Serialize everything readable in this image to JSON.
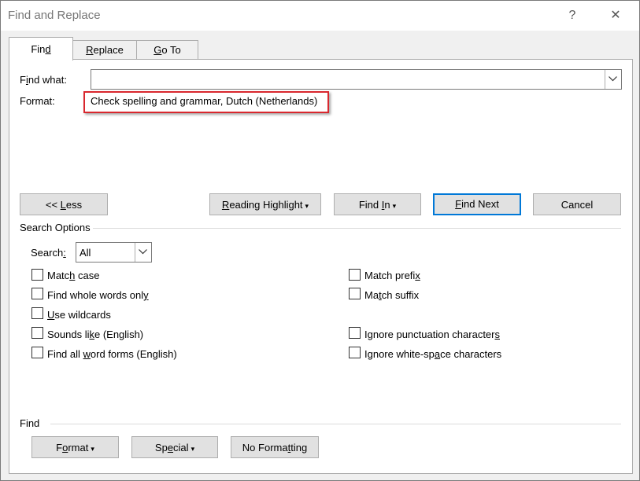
{
  "window": {
    "title": "Find and Replace",
    "help_glyph": "?",
    "close_glyph": "✕"
  },
  "tabs": [
    {
      "label_pre": "Fin",
      "label_ul": "d",
      "label_post": ""
    },
    {
      "label_pre": "",
      "label_ul": "R",
      "label_post": "eplace"
    },
    {
      "label_pre": "",
      "label_ul": "G",
      "label_post": "o To"
    }
  ],
  "find": {
    "label_pre": "F",
    "label_ul": "i",
    "label_post": "nd what:",
    "value": "",
    "format_label": "Format:",
    "format_value": "Check spelling and grammar, Dutch (Netherlands)"
  },
  "buttons": {
    "less_pre": "<< ",
    "less_ul": "L",
    "less_post": "ess",
    "reading_ul": "R",
    "reading_post": "eading Highlight",
    "findin_pre": "Find ",
    "findin_ul": "I",
    "findin_post": "n",
    "findnext_ul": "F",
    "findnext_post": "ind Next",
    "cancel": "Cancel",
    "caret": "▾"
  },
  "search_options": {
    "heading": "Search Options",
    "search_label_pre": "Search",
    "search_label_ul": ":",
    "search_value": "All",
    "left": [
      {
        "pre": "Matc",
        "ul": "h",
        "post": " case"
      },
      {
        "pre": "Find whole words onl",
        "ul": "y",
        "post": ""
      },
      {
        "pre": "",
        "ul": "U",
        "post": "se wildcards"
      },
      {
        "pre": "Sounds li",
        "ul": "k",
        "post": "e (English)"
      },
      {
        "pre": "Find all ",
        "ul": "w",
        "post": "ord forms (English)"
      }
    ],
    "right": [
      {
        "pre": "Match prefi",
        "ul": "x",
        "post": ""
      },
      {
        "pre": "Ma",
        "ul": "t",
        "post": "ch suffix"
      },
      {
        "pre": "Ignore punctuation character",
        "ul": "s",
        "post": ""
      },
      {
        "pre": "Ignore white-sp",
        "ul": "a",
        "post": "ce characters"
      }
    ]
  },
  "bottom": {
    "heading": "Find",
    "format_pre": "F",
    "format_ul": "o",
    "format_post": "rmat",
    "special_pre": "Sp",
    "special_ul": "e",
    "special_post": "cial",
    "noformat_pre": "No Forma",
    "noformat_ul": "t",
    "noformat_post": "ting"
  }
}
